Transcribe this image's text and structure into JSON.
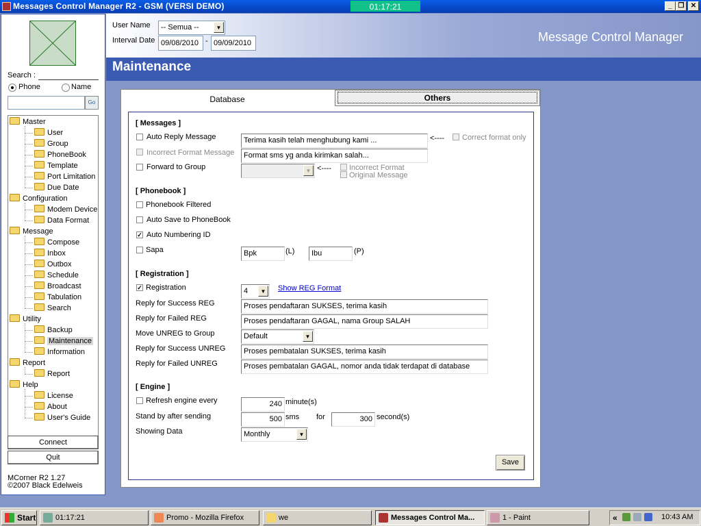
{
  "window": {
    "title": "Messages Control Manager R2 - GSM  (VERSI DEMO)",
    "clock": "01:17:21",
    "buttons": {
      "minimize": "_",
      "restore": "❐",
      "close": "✕"
    }
  },
  "sidebar": {
    "search_label": "Search :",
    "radio_phone": "Phone",
    "radio_name": "Name",
    "selected_radio": "Phone",
    "search_value": "",
    "go_label": "Go",
    "tree": [
      {
        "label": "Master",
        "level": 0
      },
      {
        "label": "User",
        "level": 1
      },
      {
        "label": "Group",
        "level": 1
      },
      {
        "label": "PhoneBook",
        "level": 1
      },
      {
        "label": "Template",
        "level": 1
      },
      {
        "label": "Port Limitation",
        "level": 1
      },
      {
        "label": "Due Date",
        "level": 1
      },
      {
        "label": "Configuration",
        "level": 0
      },
      {
        "label": "Modem Device",
        "level": 1
      },
      {
        "label": "Data Format",
        "level": 1
      },
      {
        "label": "Message",
        "level": 0
      },
      {
        "label": "Compose",
        "level": 1
      },
      {
        "label": "Inbox",
        "level": 1
      },
      {
        "label": "Outbox",
        "level": 1
      },
      {
        "label": "Schedule",
        "level": 1
      },
      {
        "label": "Broadcast",
        "level": 1
      },
      {
        "label": "Tabulation",
        "level": 1
      },
      {
        "label": "Search",
        "level": 1
      },
      {
        "label": "Utility",
        "level": 0
      },
      {
        "label": "Backup",
        "level": 1
      },
      {
        "label": "Maintenance",
        "level": 1,
        "selected": true
      },
      {
        "label": "Information",
        "level": 1
      },
      {
        "label": "Report",
        "level": 0
      },
      {
        "label": "Report",
        "level": 1
      },
      {
        "label": "Help",
        "level": 0
      },
      {
        "label": "License",
        "level": 1
      },
      {
        "label": "About",
        "level": 1
      },
      {
        "label": "User's Guide",
        "level": 1
      }
    ],
    "connect_label": "Connect",
    "quit_label": "Quit",
    "version": "MCorner R2  1.27",
    "copyright": "©2007 Black Edelweis"
  },
  "header": {
    "user_name_label": "User Name",
    "user_name_value": "-- Semua --",
    "interval_label": "Interval Date",
    "date_from": "09/08/2010",
    "date_sep": "-",
    "date_to": "09/09/2010",
    "app_title": "Message Control Manager",
    "page_title": "Maintenance"
  },
  "tabs": {
    "database": "Database",
    "others": "Others",
    "active": "Others"
  },
  "messages": {
    "section": "[ Messages ]",
    "auto_reply_label": "Auto Reply Message",
    "auto_reply_checked": false,
    "auto_reply_text": "Terima kasih telah menghubung kami ...",
    "arrow": "<----",
    "correct_format_only": "Correct format only",
    "incorrect_format_label": "Incorrect Format Message",
    "incorrect_format_text": "Format sms yg anda kirimkan salah...",
    "forward_label": "Forward to Group",
    "forward_checked": false,
    "forward_group_value": "",
    "opt_incorrect_format": "Incorrect Format",
    "opt_original_message": "Original Message"
  },
  "phonebook": {
    "section": "[ Phonebook ]",
    "filtered_label": "Phonebook Filtered",
    "filtered_checked": false,
    "autosave_label": "Auto Save to PhoneBook",
    "autosave_checked": false,
    "autonum_label": "Auto Numbering ID",
    "autonum_checked": true,
    "sapa_label": "Sapa",
    "sapa_checked": false,
    "sapa_l_value": "Bpk",
    "sapa_l_suffix": "(L)",
    "sapa_p_value": "Ibu",
    "sapa_p_suffix": "(P)"
  },
  "registration": {
    "section": "[ Registration ]",
    "reg_label": "Registration",
    "reg_checked": true,
    "reg_value": "4",
    "show_format_link": "Show REG Format",
    "success_reg_label": "Reply for Success REG",
    "success_reg_text": "Proses pendaftaran SUKSES, terima kasih",
    "failed_reg_label": "Reply for Failed REG",
    "failed_reg_text": "Proses pendaftaran GAGAL, nama Group SALAH",
    "move_unreg_label": "Move UNREG to Group",
    "move_unreg_value": "Default",
    "success_unreg_label": "Reply for Success UNREG",
    "success_unreg_text": "Proses pembatalan SUKSES, terima kasih",
    "failed_unreg_label": "Reply for Failed UNREG",
    "failed_unreg_text": "Proses pembatalan GAGAL, nomor anda tidak terdapat di database"
  },
  "engine": {
    "section": "[ Engine ]",
    "refresh_label": "Refresh engine every",
    "refresh_checked": false,
    "refresh_value": "240",
    "refresh_unit": "minute(s)",
    "standby_label": "Stand by after sending",
    "standby_value": "500",
    "standby_unit": "sms",
    "for_label": "for",
    "for_value": "300",
    "for_unit": "second(s)",
    "showing_label": "Showing Data",
    "showing_value": "Monthly",
    "save_label": "Save"
  },
  "taskbar": {
    "start": "Start",
    "items": [
      {
        "label": "01:17:21",
        "icon": "clock-app-icon"
      },
      {
        "label": "Promo - Mozilla Firefox",
        "icon": "firefox-icon"
      },
      {
        "label": "we",
        "icon": "folder-icon"
      },
      {
        "label": "Messages Control Ma...",
        "icon": "app-icon",
        "active": true
      },
      {
        "label": "1 - Paint",
        "icon": "paint-icon"
      }
    ],
    "tray_chevron": "«",
    "time": "10:43 AM"
  }
}
